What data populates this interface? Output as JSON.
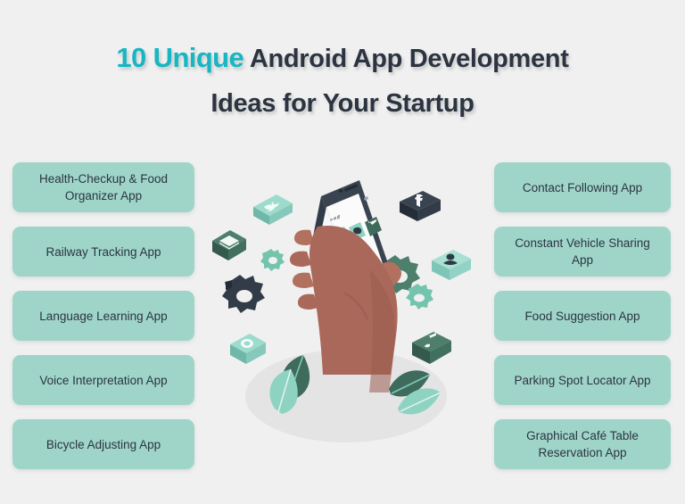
{
  "background_color": "#f0f0f0",
  "title": {
    "accent_text": "10 Unique",
    "accent_color": "#17b6c2",
    "line1_rest": "Android App Development",
    "line2": "Ideas for Your Startup",
    "text_color": "#2b3440"
  },
  "pill_color": "#9fd5c9",
  "pill_text_color": "#2b3440",
  "left_column": [
    {
      "label": "Health-Checkup & Food Organizer App"
    },
    {
      "label": "Railway Tracking App"
    },
    {
      "label": "Language Learning App"
    },
    {
      "label": "Voice Interpretation App"
    },
    {
      "label": "Bicycle Adjusting App"
    }
  ],
  "right_column": [
    {
      "label": "Contact Following App"
    },
    {
      "label": "Constant Vehicle Sharing App"
    },
    {
      "label": "Food Suggestion App"
    },
    {
      "label": "Parking Spot Locator App"
    },
    {
      "label": "Graphical Café Table Reservation App"
    }
  ],
  "illustration": {
    "description": "Isometric hand holding a smartphone with an app grid, surrounded by floating 3D app icons and leaves",
    "hand_color": "#a9685a",
    "phone_body_color": "#3a4450",
    "screen_color": "#fbfbfb",
    "ground_ellipse_color": "#e4e4e4",
    "floating_icons": [
      {
        "name": "twitter-icon",
        "side": "left",
        "color": "#7fc9bb"
      },
      {
        "name": "envelope-icon",
        "side": "left",
        "color": "#3f6b5c"
      },
      {
        "name": "gear-icon-small-mint",
        "side": "left",
        "color": "#74c4ad"
      },
      {
        "name": "gear-icon-large-dark",
        "side": "left",
        "color": "#313c48"
      },
      {
        "name": "camera-icon",
        "side": "left",
        "color": "#7fc9bb"
      },
      {
        "name": "facebook-icon",
        "side": "right",
        "color": "#313c48"
      },
      {
        "name": "gear-icon-large-green",
        "side": "right",
        "color": "#4c7f6c"
      },
      {
        "name": "gear-icon-small-green",
        "side": "right",
        "color": "#74c4ad"
      },
      {
        "name": "user-icon",
        "side": "right",
        "color": "#a8e0d4"
      },
      {
        "name": "music-note-icon",
        "side": "right",
        "color": "#3f6b5c"
      }
    ],
    "screen_apps": [
      "photo-icon",
      "ghost-icon",
      "envelope-icon",
      "instagram-icon",
      "facebook-icon",
      "twitter-icon",
      "video-icon",
      "gear-icon",
      "music-icon",
      "play-icon",
      "image-icon",
      "user-icon"
    ]
  }
}
